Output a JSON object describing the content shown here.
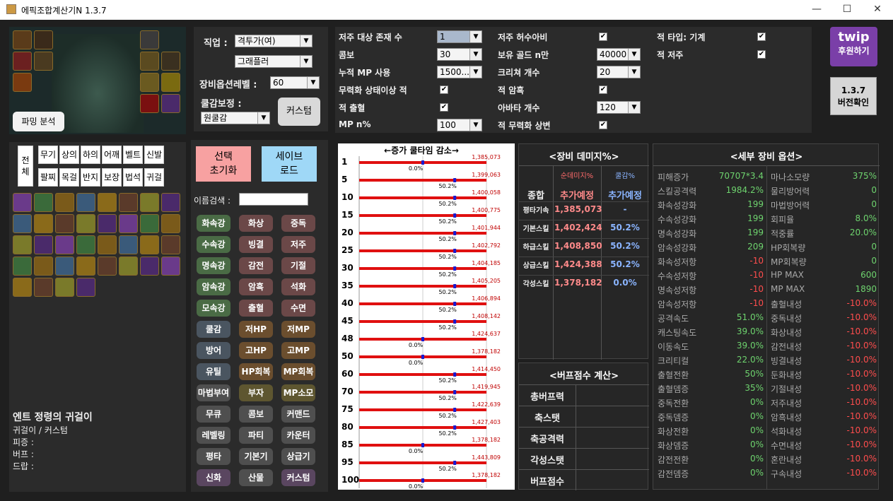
{
  "window": {
    "title": "에픽조합계산기N 1.3.7",
    "minimize": "—",
    "maximize": "☐",
    "close": "✕"
  },
  "left": {
    "farming_button": "파밍 분석",
    "item_name": "엔트 정령의 귀걸이",
    "item_type": "귀걸이 / 커스텀",
    "stats": [
      "피증 :",
      "버프 :",
      "드랍 :"
    ],
    "slot_tabs": [
      "전체",
      "무기",
      "상의",
      "하의",
      "어깨",
      "벨트",
      "신발",
      "팔찌",
      "목걸",
      "반지",
      "보장",
      "법석",
      "귀걸"
    ]
  },
  "class_panel": {
    "job_label": "직업 :",
    "job_value": "격투가(여)",
    "subclass_value": "그래플러",
    "equip_level_label": "장비옵션레벨 :",
    "equip_level_value": "60",
    "cool_label": "쿨감보정 :",
    "cool_value": "원쿨감",
    "custom_button": "커스텀"
  },
  "actions": {
    "reset_button": "선택\n초기화",
    "save_button": "세이브\n로드",
    "search_label": "이름검색 :",
    "search_value": ""
  },
  "filters": [
    {
      "label": "화속강",
      "color": "#4a6b45"
    },
    {
      "label": "화상",
      "color": "#6b4848"
    },
    {
      "label": "중독",
      "color": "#6b4848"
    },
    {
      "label": "수속강",
      "color": "#4a6b45"
    },
    {
      "label": "빙결",
      "color": "#6b4848"
    },
    {
      "label": "저주",
      "color": "#6b4848"
    },
    {
      "label": "명속강",
      "color": "#4a6b45"
    },
    {
      "label": "감전",
      "color": "#6b4848"
    },
    {
      "label": "기절",
      "color": "#6b4848"
    },
    {
      "label": "암속강",
      "color": "#4a6b45"
    },
    {
      "label": "암흑",
      "color": "#6b4848"
    },
    {
      "label": "석화",
      "color": "#6b4848"
    },
    {
      "label": "모속강",
      "color": "#4a6b45"
    },
    {
      "label": "출혈",
      "color": "#6b4848"
    },
    {
      "label": "수면",
      "color": "#6b4848"
    },
    {
      "label": "쿨감",
      "color": "#4a5560"
    },
    {
      "label": "저HP",
      "color": "#6b4e2e"
    },
    {
      "label": "저MP",
      "color": "#6b4e2e"
    },
    {
      "label": "방어",
      "color": "#4a5560"
    },
    {
      "label": "고HP",
      "color": "#6b4e2e"
    },
    {
      "label": "고MP",
      "color": "#6b4e2e"
    },
    {
      "label": "유틸",
      "color": "#4a5560"
    },
    {
      "label": "HP회복",
      "color": "#6b4e2e"
    },
    {
      "label": "MP회복",
      "color": "#6b4e2e"
    },
    {
      "label": "마법부여",
      "color": "#4f4f4f"
    },
    {
      "label": "부자",
      "color": "#5e5630"
    },
    {
      "label": "MP소모",
      "color": "#5e5630"
    },
    {
      "label": "무큐",
      "color": "#4f4f4f"
    },
    {
      "label": "콤보",
      "color": "#4f4f4f"
    },
    {
      "label": "커맨드",
      "color": "#4f4f4f"
    },
    {
      "label": "레벨링",
      "color": "#4f4f4f"
    },
    {
      "label": "파티",
      "color": "#4f4f4f"
    },
    {
      "label": "카운터",
      "color": "#4f4f4f"
    },
    {
      "label": "평타",
      "color": "#4f4f4f"
    },
    {
      "label": "기본기",
      "color": "#4f4f4f"
    },
    {
      "label": "상급기",
      "color": "#4f4f4f"
    },
    {
      "label": "신화",
      "color": "#5a4660"
    },
    {
      "label": "산물",
      "color": "#4f4f4f"
    },
    {
      "label": "커스텀",
      "color": "#5a4660"
    }
  ],
  "settings": {
    "col1": [
      {
        "label": "저주 대상 존재 수",
        "value": "1"
      },
      {
        "label": "콤보",
        "value": "30"
      },
      {
        "label": "누적 MP 사용",
        "value": "1500..."
      },
      {
        "label": "무력화 상태이상 적",
        "check": "✔"
      },
      {
        "label": "적 출혈",
        "check": "✔"
      },
      {
        "label": "MP n%",
        "value": "100"
      }
    ],
    "col2": [
      {
        "label": "저주 허수아비",
        "check": "✔"
      },
      {
        "label": "보유 골드 n만",
        "value": "40000"
      },
      {
        "label": "크리쳐 개수",
        "value": "20"
      },
      {
        "label": "적 암흑",
        "check": "✔"
      },
      {
        "label": "아바타 개수",
        "value": "120"
      },
      {
        "label": "적 무력화 상변",
        "check": "✔"
      }
    ],
    "col3": [
      {
        "label": "적 타입: 기계",
        "check": "✔"
      },
      {
        "label": "적 저주",
        "check": "✔"
      }
    ]
  },
  "twip": {
    "logo": "twip",
    "donate": "후원하기",
    "version_button": "1.3.7\n버전확인"
  },
  "cooldown_chart": {
    "header": "←증가  쿨타임  감소→",
    "rows": [
      {
        "level": "1",
        "value": "1,385,073",
        "pct": "0.0%",
        "p": 0.0
      },
      {
        "level": "5",
        "value": "1,399,063",
        "pct": "50.2%",
        "p": 0.502
      },
      {
        "level": "10",
        "value": "1,400,058",
        "pct": "50.2%",
        "p": 0.502
      },
      {
        "level": "15",
        "value": "1,400,775",
        "pct": "50.2%",
        "p": 0.502
      },
      {
        "level": "20",
        "value": "1,401,944",
        "pct": "50.2%",
        "p": 0.502
      },
      {
        "level": "25",
        "value": "1,402,792",
        "pct": "50.2%",
        "p": 0.502
      },
      {
        "level": "30",
        "value": "1,404,185",
        "pct": "50.2%",
        "p": 0.502
      },
      {
        "level": "35",
        "value": "1,405,205",
        "pct": "50.2%",
        "p": 0.502
      },
      {
        "level": "40",
        "value": "1,406,894",
        "pct": "50.2%",
        "p": 0.502
      },
      {
        "level": "45",
        "value": "1,408,142",
        "pct": "50.2%",
        "p": 0.502
      },
      {
        "level": "48",
        "value": "1,424,637",
        "pct": "0.0%",
        "p": 0.0
      },
      {
        "level": "50",
        "value": "1,378,182",
        "pct": "0.0%",
        "p": 0.0
      },
      {
        "level": "60",
        "value": "1,414,450",
        "pct": "50.2%",
        "p": 0.502
      },
      {
        "level": "70",
        "value": "1,419,945",
        "pct": "50.2%",
        "p": 0.502
      },
      {
        "level": "75",
        "value": "1,422,639",
        "pct": "50.2%",
        "p": 0.502
      },
      {
        "level": "80",
        "value": "1,427,403",
        "pct": "50.2%",
        "p": 0.502
      },
      {
        "level": "85",
        "value": "1,378,182",
        "pct": "0.0%",
        "p": 0.0
      },
      {
        "level": "95",
        "value": "1,443,809",
        "pct": "50.2%",
        "p": 0.502
      },
      {
        "level": "100",
        "value": "1,378,182",
        "pct": "0.0%",
        "p": 0.0
      }
    ]
  },
  "damage": {
    "title": "<장비 데미지%>",
    "col_damage": "순데미지%",
    "col_cool": "쿨감%",
    "summary_label": "종합",
    "summary_damage": "추가예정",
    "summary_cool": "추가예정",
    "rows": [
      {
        "label": "평타기속",
        "damage": "1,385,073",
        "cool": "-"
      },
      {
        "label": "기본스킬",
        "damage": "1,402,424",
        "cool": "50.2%"
      },
      {
        "label": "하급스킬",
        "damage": "1,408,850",
        "cool": "50.2%"
      },
      {
        "label": "상급스킬",
        "damage": "1,424,388",
        "cool": "50.2%"
      },
      {
        "label": "각성스킬",
        "damage": "1,378,182",
        "cool": "0.0%"
      }
    ]
  },
  "buff": {
    "title": "<버프점수 계산>",
    "rows": [
      "총버프력",
      "축스탯",
      "축공격력",
      "각성스탯",
      "버프점수"
    ]
  },
  "detail": {
    "title": "<세부 장비 옵션>",
    "left": [
      {
        "name": "피해증가",
        "value": "70707*3.4"
      },
      {
        "name": "스킬공격력",
        "value": "1984.2%"
      },
      {
        "name": "화속성강화",
        "value": "199"
      },
      {
        "name": "수속성강화",
        "value": "199"
      },
      {
        "name": "명속성강화",
        "value": "199"
      },
      {
        "name": "암속성강화",
        "value": "209"
      },
      {
        "name": "화속성저항",
        "value": "-10",
        "red": true
      },
      {
        "name": "수속성저항",
        "value": "-10",
        "red": true
      },
      {
        "name": "명속성저항",
        "value": "-10",
        "red": true
      },
      {
        "name": "암속성저항",
        "value": "-10",
        "red": true
      },
      {
        "name": "공격속도",
        "value": "51.0%"
      },
      {
        "name": "캐스팅속도",
        "value": "39.0%"
      },
      {
        "name": "이동속도",
        "value": "39.0%"
      },
      {
        "name": "크리티컬",
        "value": "22.0%"
      },
      {
        "name": "출혈전환",
        "value": "50%"
      },
      {
        "name": "출혈뎀증",
        "value": "35%"
      },
      {
        "name": "중독전환",
        "value": "0%"
      },
      {
        "name": "중독뎀증",
        "value": "0%"
      },
      {
        "name": "화상전환",
        "value": "0%"
      },
      {
        "name": "화상뎀증",
        "value": "0%"
      },
      {
        "name": "감전전환",
        "value": "0%"
      },
      {
        "name": "감전뎀증",
        "value": "0%"
      }
    ],
    "right": [
      {
        "name": "마나소모량",
        "value": "375%"
      },
      {
        "name": "물리방어력",
        "value": "0"
      },
      {
        "name": "마법방어력",
        "value": "0"
      },
      {
        "name": "회피율",
        "value": "8.0%"
      },
      {
        "name": "적중률",
        "value": "20.0%"
      },
      {
        "name": "HP회복량",
        "value": "0"
      },
      {
        "name": "MP회복량",
        "value": "0"
      },
      {
        "name": "HP MAX",
        "value": "600"
      },
      {
        "name": "MP MAX",
        "value": "1890"
      },
      {
        "name": "출혈내성",
        "value": "-10.0%",
        "red": true
      },
      {
        "name": "중독내성",
        "value": "-10.0%",
        "red": true
      },
      {
        "name": "화상내성",
        "value": "-10.0%",
        "red": true
      },
      {
        "name": "감전내성",
        "value": "-10.0%",
        "red": true
      },
      {
        "name": "빙결내성",
        "value": "-10.0%",
        "red": true
      },
      {
        "name": "둔화내성",
        "value": "-10.0%",
        "red": true
      },
      {
        "name": "기절내성",
        "value": "-10.0%",
        "red": true
      },
      {
        "name": "저주내성",
        "value": "-10.0%",
        "red": true
      },
      {
        "name": "암흑내성",
        "value": "-10.0%",
        "red": true
      },
      {
        "name": "석화내성",
        "value": "-10.0%",
        "red": true
      },
      {
        "name": "수면내성",
        "value": "-10.0%",
        "red": true
      },
      {
        "name": "혼란내성",
        "value": "-10.0%",
        "red": true
      },
      {
        "name": "구속내성",
        "value": "-10.0%",
        "red": true
      }
    ]
  }
}
